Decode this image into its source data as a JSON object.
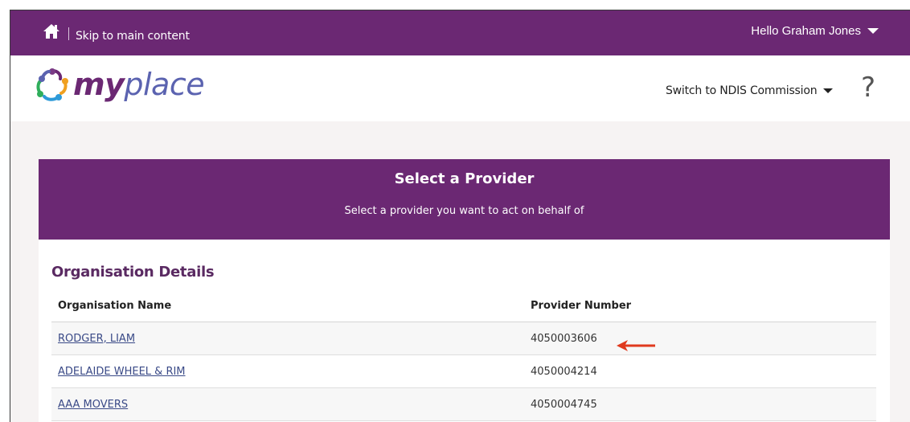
{
  "topbar": {
    "skip_link": "Skip to main content",
    "user_greeting": "Hello Graham Jones",
    "icons": [
      "home-icon",
      "chevron-down-icon"
    ]
  },
  "header": {
    "logo_my": "my",
    "logo_place": "place",
    "switch_label": "Switch to NDIS Commission",
    "help_label": "?"
  },
  "banner": {
    "title": "Select a Provider",
    "subtitle": "Select a provider you want to act on behalf of"
  },
  "organisation_details": {
    "title": "Organisation Details",
    "columns": [
      "Organisation Name",
      "Provider Number"
    ],
    "rows": [
      {
        "name": "RODGER, LIAM ",
        "provider_number": "4050003606"
      },
      {
        "name": "ADELAIDE WHEEL & RIM",
        "provider_number": "4050004214"
      },
      {
        "name": "AAA MOVERS",
        "provider_number": "4050004745"
      }
    ]
  },
  "colors": {
    "brand_purple": "#6b2873",
    "link_blue": "#3a4a87",
    "annotation_red": "#e03a1e"
  }
}
